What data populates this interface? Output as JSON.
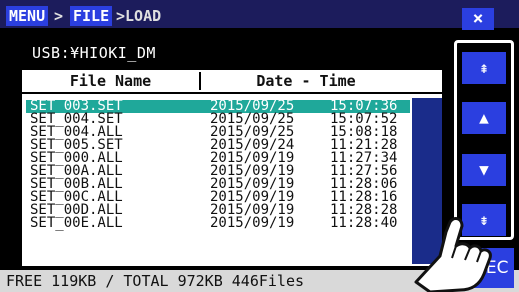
{
  "breadcrumb": {
    "menu": "MENU",
    "sep1": ">",
    "file": "FILE",
    "sep2": ">LOAD"
  },
  "close_label": "×",
  "path": "USB:¥HIOKI_DM",
  "columns": {
    "name": "File Name",
    "datetime": "Date - Time"
  },
  "files": [
    {
      "name": "SET_003.SET",
      "date": "2015/09/25",
      "time": "15:07:36",
      "selected": true
    },
    {
      "name": "SET_004.SET",
      "date": "2015/09/25",
      "time": "15:07:52"
    },
    {
      "name": "SET_004.ALL",
      "date": "2015/09/25",
      "time": "15:08:18"
    },
    {
      "name": "SET_005.SET",
      "date": "2015/09/24",
      "time": "11:21:28"
    },
    {
      "name": "SET_000.ALL",
      "date": "2015/09/19",
      "time": "11:27:34"
    },
    {
      "name": "SET_00A.ALL",
      "date": "2015/09/19",
      "time": "11:27:56"
    },
    {
      "name": "SET_00B.ALL",
      "date": "2015/09/19",
      "time": "11:28:06"
    },
    {
      "name": "SET_00C.ALL",
      "date": "2015/09/19",
      "time": "11:28:16"
    },
    {
      "name": "SET_00D.ALL",
      "date": "2015/09/19",
      "time": "11:28:28"
    },
    {
      "name": "SET_00E.ALL",
      "date": "2015/09/19",
      "time": "11:28:40"
    }
  ],
  "nav": {
    "top": "⇞",
    "up": "▲",
    "down": "▼",
    "bottom": "⇟"
  },
  "status": "FREE 119KB / TOTAL 972KB 446Files",
  "exec_label": "EXEC",
  "colors": {
    "header": "#1c1c5c",
    "accent": "#2b3fe0",
    "selection": "#1fa89a",
    "scrollbar": "#1a2c8a"
  }
}
